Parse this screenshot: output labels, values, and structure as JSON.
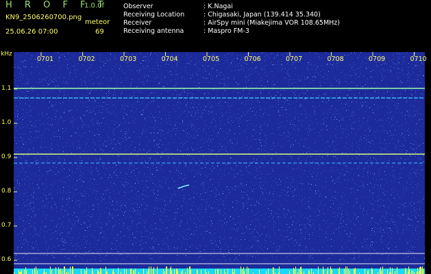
{
  "header": {
    "app_title": "H R O F F T",
    "version": "1.0.0f",
    "filename": "KN9_2506260700.png",
    "meteor_label": "meteor",
    "datetime": "25.06.26 07:00",
    "meteor_count": "69"
  },
  "info": [
    {
      "label": "Observer",
      "value": ": K.Nagai"
    },
    {
      "label": "Receiving Location",
      "value": ": Chigasaki, Japan (139.414 35.340)"
    },
    {
      "label": "Receiver",
      "value": ": AirSpy mini (Miakejima VOR 108.65MHz)"
    },
    {
      "label": "Receiving antenna",
      "value": ": Maspro FM-3"
    }
  ],
  "axis": {
    "y_unit": "kHz",
    "y_ticks": [
      "1.1",
      "1.0",
      "0.9",
      "0.8",
      "0.7",
      "0.6"
    ],
    "x_ticks": [
      "0701",
      "0702",
      "0703",
      "0704",
      "0705",
      "0706",
      "0707",
      "0708",
      "0709",
      "0710"
    ]
  },
  "colors": {
    "background": "#000000",
    "spectrogram": "#1c2a9a",
    "label_green": "#9fe07a",
    "tick_yellow": "#ffff66",
    "signal_cyan": "#00e5ff"
  }
}
